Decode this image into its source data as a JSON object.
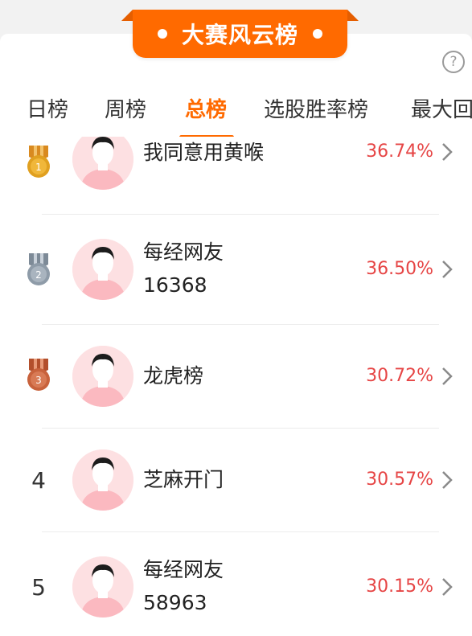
{
  "banner": {
    "title": "大赛风云榜"
  },
  "tabs": [
    {
      "label": "日榜",
      "active": false
    },
    {
      "label": "周榜",
      "active": false
    },
    {
      "label": "总榜",
      "active": true
    },
    {
      "label": "选股胜率榜",
      "active": false
    },
    {
      "label": "最大回",
      "active": false
    }
  ],
  "ranking": [
    {
      "rank": "1",
      "medal": "gold",
      "name_line1": "我同意用黄喉",
      "name_line2": "",
      "pct": "36.74%"
    },
    {
      "rank": "2",
      "medal": "silver",
      "name_line1": "每经网友",
      "name_line2": "16368",
      "pct": "36.50%"
    },
    {
      "rank": "3",
      "medal": "bronze",
      "name_line1": "龙虎榜",
      "name_line2": "",
      "pct": "30.72%"
    },
    {
      "rank": "4",
      "medal": "",
      "name_line1": "芝麻开门",
      "name_line2": "",
      "pct": "30.57%"
    },
    {
      "rank": "5",
      "medal": "",
      "name_line1": "每经网友",
      "name_line2": "58963",
      "pct": "30.15%"
    }
  ],
  "icons": {
    "help": "question-mark-icon",
    "chevron": "chevron-right-icon",
    "avatar": "default-avatar-icon",
    "medal": "medal-icon"
  },
  "colors": {
    "accent": "#ff6a00",
    "percent": "#e64545",
    "gold": "#e0a020",
    "silver": "#8e9ba8",
    "bronze": "#c8623c"
  }
}
